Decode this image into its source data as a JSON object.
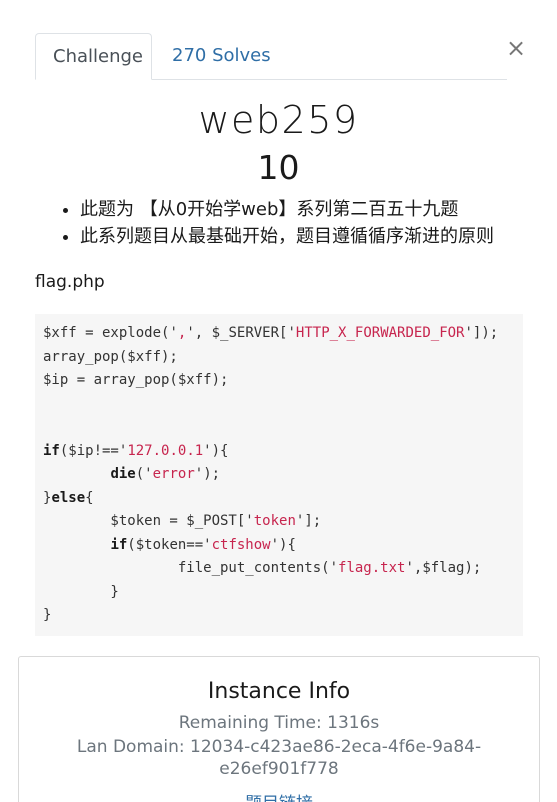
{
  "tabs": [
    {
      "label": "Challenge",
      "active": true
    },
    {
      "label": "270 Solves",
      "active": false
    }
  ],
  "close_label": "×",
  "challenge": {
    "name": "web259",
    "points": "10",
    "description": [
      "此题为 【从0开始学web】系列第二百五十九题",
      "此系列题目从最基础开始，题目遵循循序渐进的原则"
    ],
    "file_label": "flag.php"
  },
  "code_lines": [
    "$xff = explode(',', $_SERVER['HTTP_X_FORWARDED_FOR']);",
    "array_pop($xff);",
    "$ip = array_pop($xff);",
    "",
    "",
    "if($ip!=='127.0.0.1'){",
    "        die('error');",
    "}else{",
    "        $token = $_POST['token'];",
    "        if($token=='ctfshow'){",
    "                file_put_contents('flag.txt',$flag);",
    "        }",
    "}"
  ],
  "instance": {
    "title": "Instance Info",
    "remaining_time": "Remaining Time: 1316s",
    "lan_domain_line1": "Lan Domain: 12034-c423ae86-2eca-4f6e-9a84-",
    "lan_domain_line2": "e26ef901f778",
    "link_label": "题目链接"
  },
  "colors": {
    "link": "#2f6ea6",
    "string": "#c7254e",
    "code_bg": "#f6f6f6"
  }
}
